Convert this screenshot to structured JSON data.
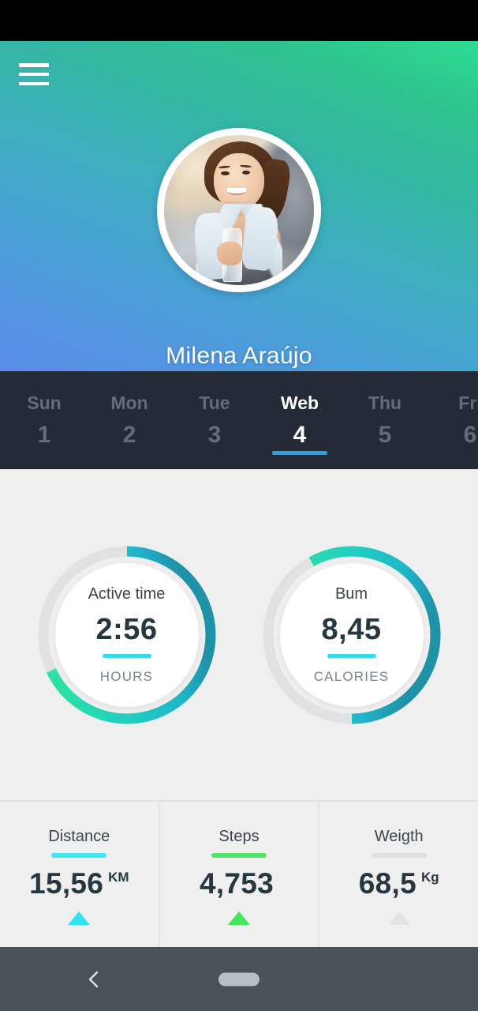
{
  "app": {
    "background_color": "#efefef",
    "header_gradient_from": "#2ddc92",
    "header_gradient_to": "#5b8ce9",
    "accent_cyan": "#35dbe8",
    "accent_green": "#4ce764",
    "accent_blue": "#2a9fe0",
    "dark_value_color": "#27373f",
    "daystrip_bg": "#252b36",
    "navbar_bg": "#4b5156"
  },
  "header": {
    "menu_icon": "hamburger-icon",
    "avatar_alt": "profile-photo-woman-with-towel-and-water-bottle",
    "username": "Milena Araújo"
  },
  "daystrip": {
    "days": [
      {
        "dow": "Sun",
        "num": "1",
        "active": false
      },
      {
        "dow": "Mon",
        "num": "2",
        "active": false
      },
      {
        "dow": "Tue",
        "num": "3",
        "active": false
      },
      {
        "dow": "Web",
        "num": "4",
        "active": true
      },
      {
        "dow": "Thu",
        "num": "5",
        "active": false
      },
      {
        "dow": "Fri",
        "num": "6",
        "active": false
      }
    ]
  },
  "rings": [
    {
      "name": "active-time",
      "title": "Active time",
      "value": "2:56",
      "unit": "HOURS",
      "progress_percent": 68,
      "direction": "clockwise",
      "bar_color": "#35dbe8"
    },
    {
      "name": "burn-calories",
      "title": "Bum",
      "value": "8,45",
      "unit": "CALORIES",
      "progress_percent": 58,
      "direction": "counter-clockwise",
      "bar_color": "#35dbe8"
    }
  ],
  "stats": [
    {
      "name": "distance",
      "label": "Distance",
      "value": "15,56",
      "unit": "KM",
      "bar_color": "#3ee8f0",
      "trend": "up",
      "trend_color": "#2fe3f2"
    },
    {
      "name": "steps",
      "label": "Steps",
      "value": "4,753",
      "unit": "",
      "bar_color": "#4ce764",
      "trend": "up",
      "trend_color": "#45e55c"
    },
    {
      "name": "weight",
      "label": "Weigth",
      "value": "68,5",
      "unit": "Kg",
      "bar_color": "#e0e0e0",
      "trend": "up",
      "trend_color": "#e3e3e3"
    }
  ],
  "navbar": {
    "back_icon": "chevron-left-icon",
    "home_pill": "home-pill-indicator"
  }
}
